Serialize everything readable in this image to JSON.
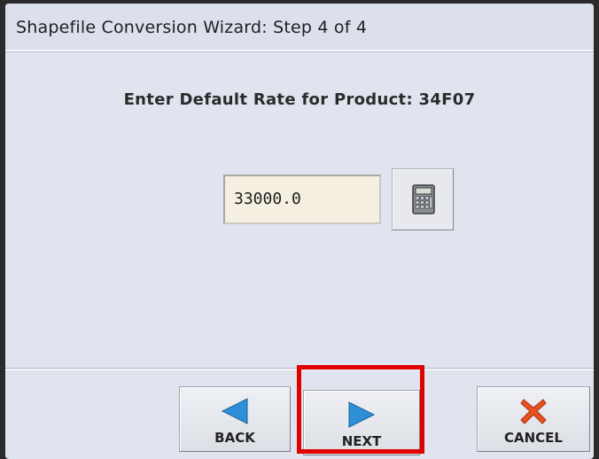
{
  "window": {
    "title": "Shapefile Conversion Wizard:  Step 4 of 4"
  },
  "prompt": {
    "text": "Enter Default Rate for Product: 34F07"
  },
  "rate_field": {
    "value": "33000.0"
  },
  "buttons": {
    "back_label": "BACK",
    "next_label": "NEXT",
    "cancel_label": "CANCEL"
  },
  "icons": {
    "calculator": "calculator-icon",
    "back": "arrow-left-icon",
    "next": "arrow-right-icon",
    "cancel": "x-icon"
  },
  "colors": {
    "arrow_blue": "#2f8fd6",
    "cancel_orange": "#e8501f",
    "highlight_red": "#e00000"
  }
}
